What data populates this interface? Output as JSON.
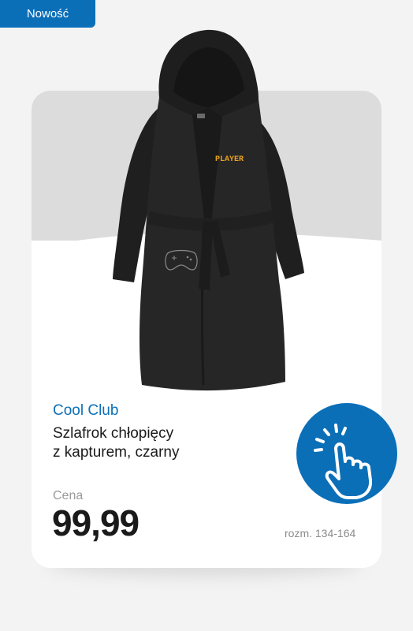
{
  "badge": {
    "label": "Nowość"
  },
  "product": {
    "brand": "Cool Club",
    "name_line1": "Szlafrok chłopięcy",
    "name_line2": "z kapturem, czarny",
    "print_text": "PLAYER",
    "price_label": "Cena",
    "price": "99,99",
    "sizes": "rozm. 134-164"
  },
  "icons": {
    "tap": "hand-tap-icon"
  },
  "colors": {
    "accent": "#0b6fb8",
    "robe": "#262626",
    "print": "#e9a21c"
  }
}
